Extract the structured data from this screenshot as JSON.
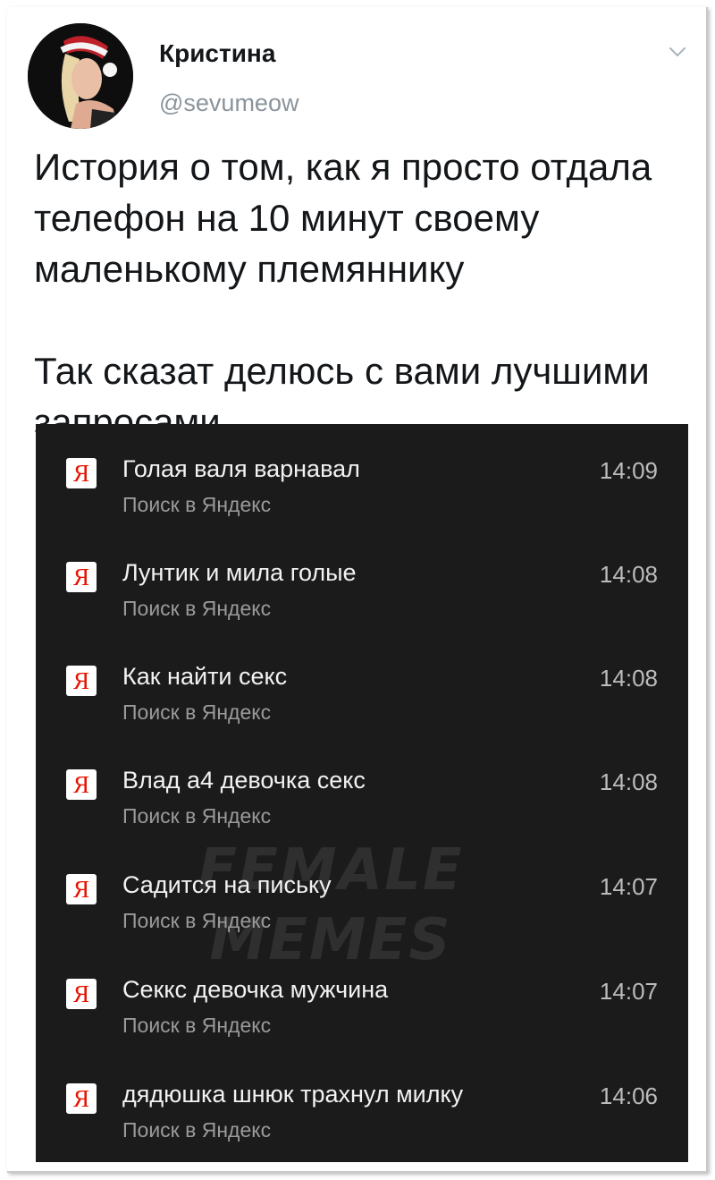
{
  "tweet": {
    "author_name": "Кристина",
    "author_handle": "@sevumeow",
    "paragraph1": "История о том, как я просто отдала телефон на 10 минут своему маленькому племяннику",
    "paragraph2": "Так сказат делюсь с вами лучшими запросами"
  },
  "icons": {
    "menu": "chevron-down-icon",
    "search_source": "yandex-logo-icon"
  },
  "screenshot": {
    "background": "#1b1b1b",
    "yandex_letter": "Я",
    "yandex_color": "#e61400",
    "watermark_line1": "FEMALE",
    "watermark_line2": "MEMES",
    "history": [
      {
        "query": "Голая валя варнавал",
        "source": "Поиск в Яндекс",
        "time": "14:09"
      },
      {
        "query": "Лунтик и мила голые",
        "source": "Поиск в Яндекс",
        "time": "14:08"
      },
      {
        "query": "Как найти секс",
        "source": "Поиск в Яндекс",
        "time": "14:08"
      },
      {
        "query": "Влад а4 девочка секс",
        "source": "Поиск в Яндекс",
        "time": "14:08"
      },
      {
        "query": "Садится на письку",
        "source": "Поиск в Яндекс",
        "time": "14:07"
      },
      {
        "query": "Секкс девочка мужчина",
        "source": "Поиск в Яндекс",
        "time": "14:07"
      },
      {
        "query": "дядюшка шнюк трахнул милку",
        "source": "Поиск в Яндекс",
        "time": "14:06"
      }
    ]
  }
}
